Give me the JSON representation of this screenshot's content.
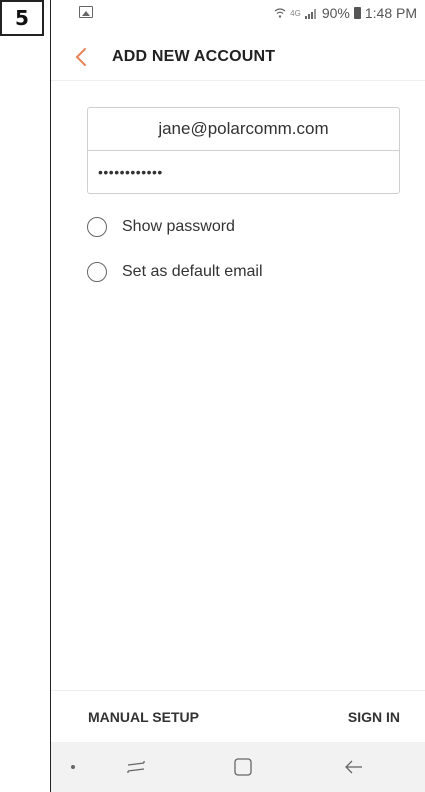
{
  "step_badge": "5",
  "status_bar": {
    "battery": "90%",
    "time": "1:48 PM",
    "network": "4G",
    "icons": [
      "image-notification-icon",
      "wifi-icon",
      "signal-icon",
      "battery-icon"
    ]
  },
  "appbar": {
    "title": "ADD NEW ACCOUNT",
    "back_icon": "chevron-left-icon",
    "accent_color": "#e9835a"
  },
  "form": {
    "email_value": "jane@polarcomm.com",
    "password_value": "••••••••••••"
  },
  "options": [
    {
      "label": "Show password",
      "checked": false
    },
    {
      "label": "Set as default email",
      "checked": false
    }
  ],
  "actions": {
    "manual_setup": "MANUAL SETUP",
    "sign_in": "SIGN IN"
  },
  "nav_bar": {
    "icons": [
      "dot-icon",
      "recent-apps-icon",
      "home-icon",
      "back-arrow-icon"
    ]
  }
}
